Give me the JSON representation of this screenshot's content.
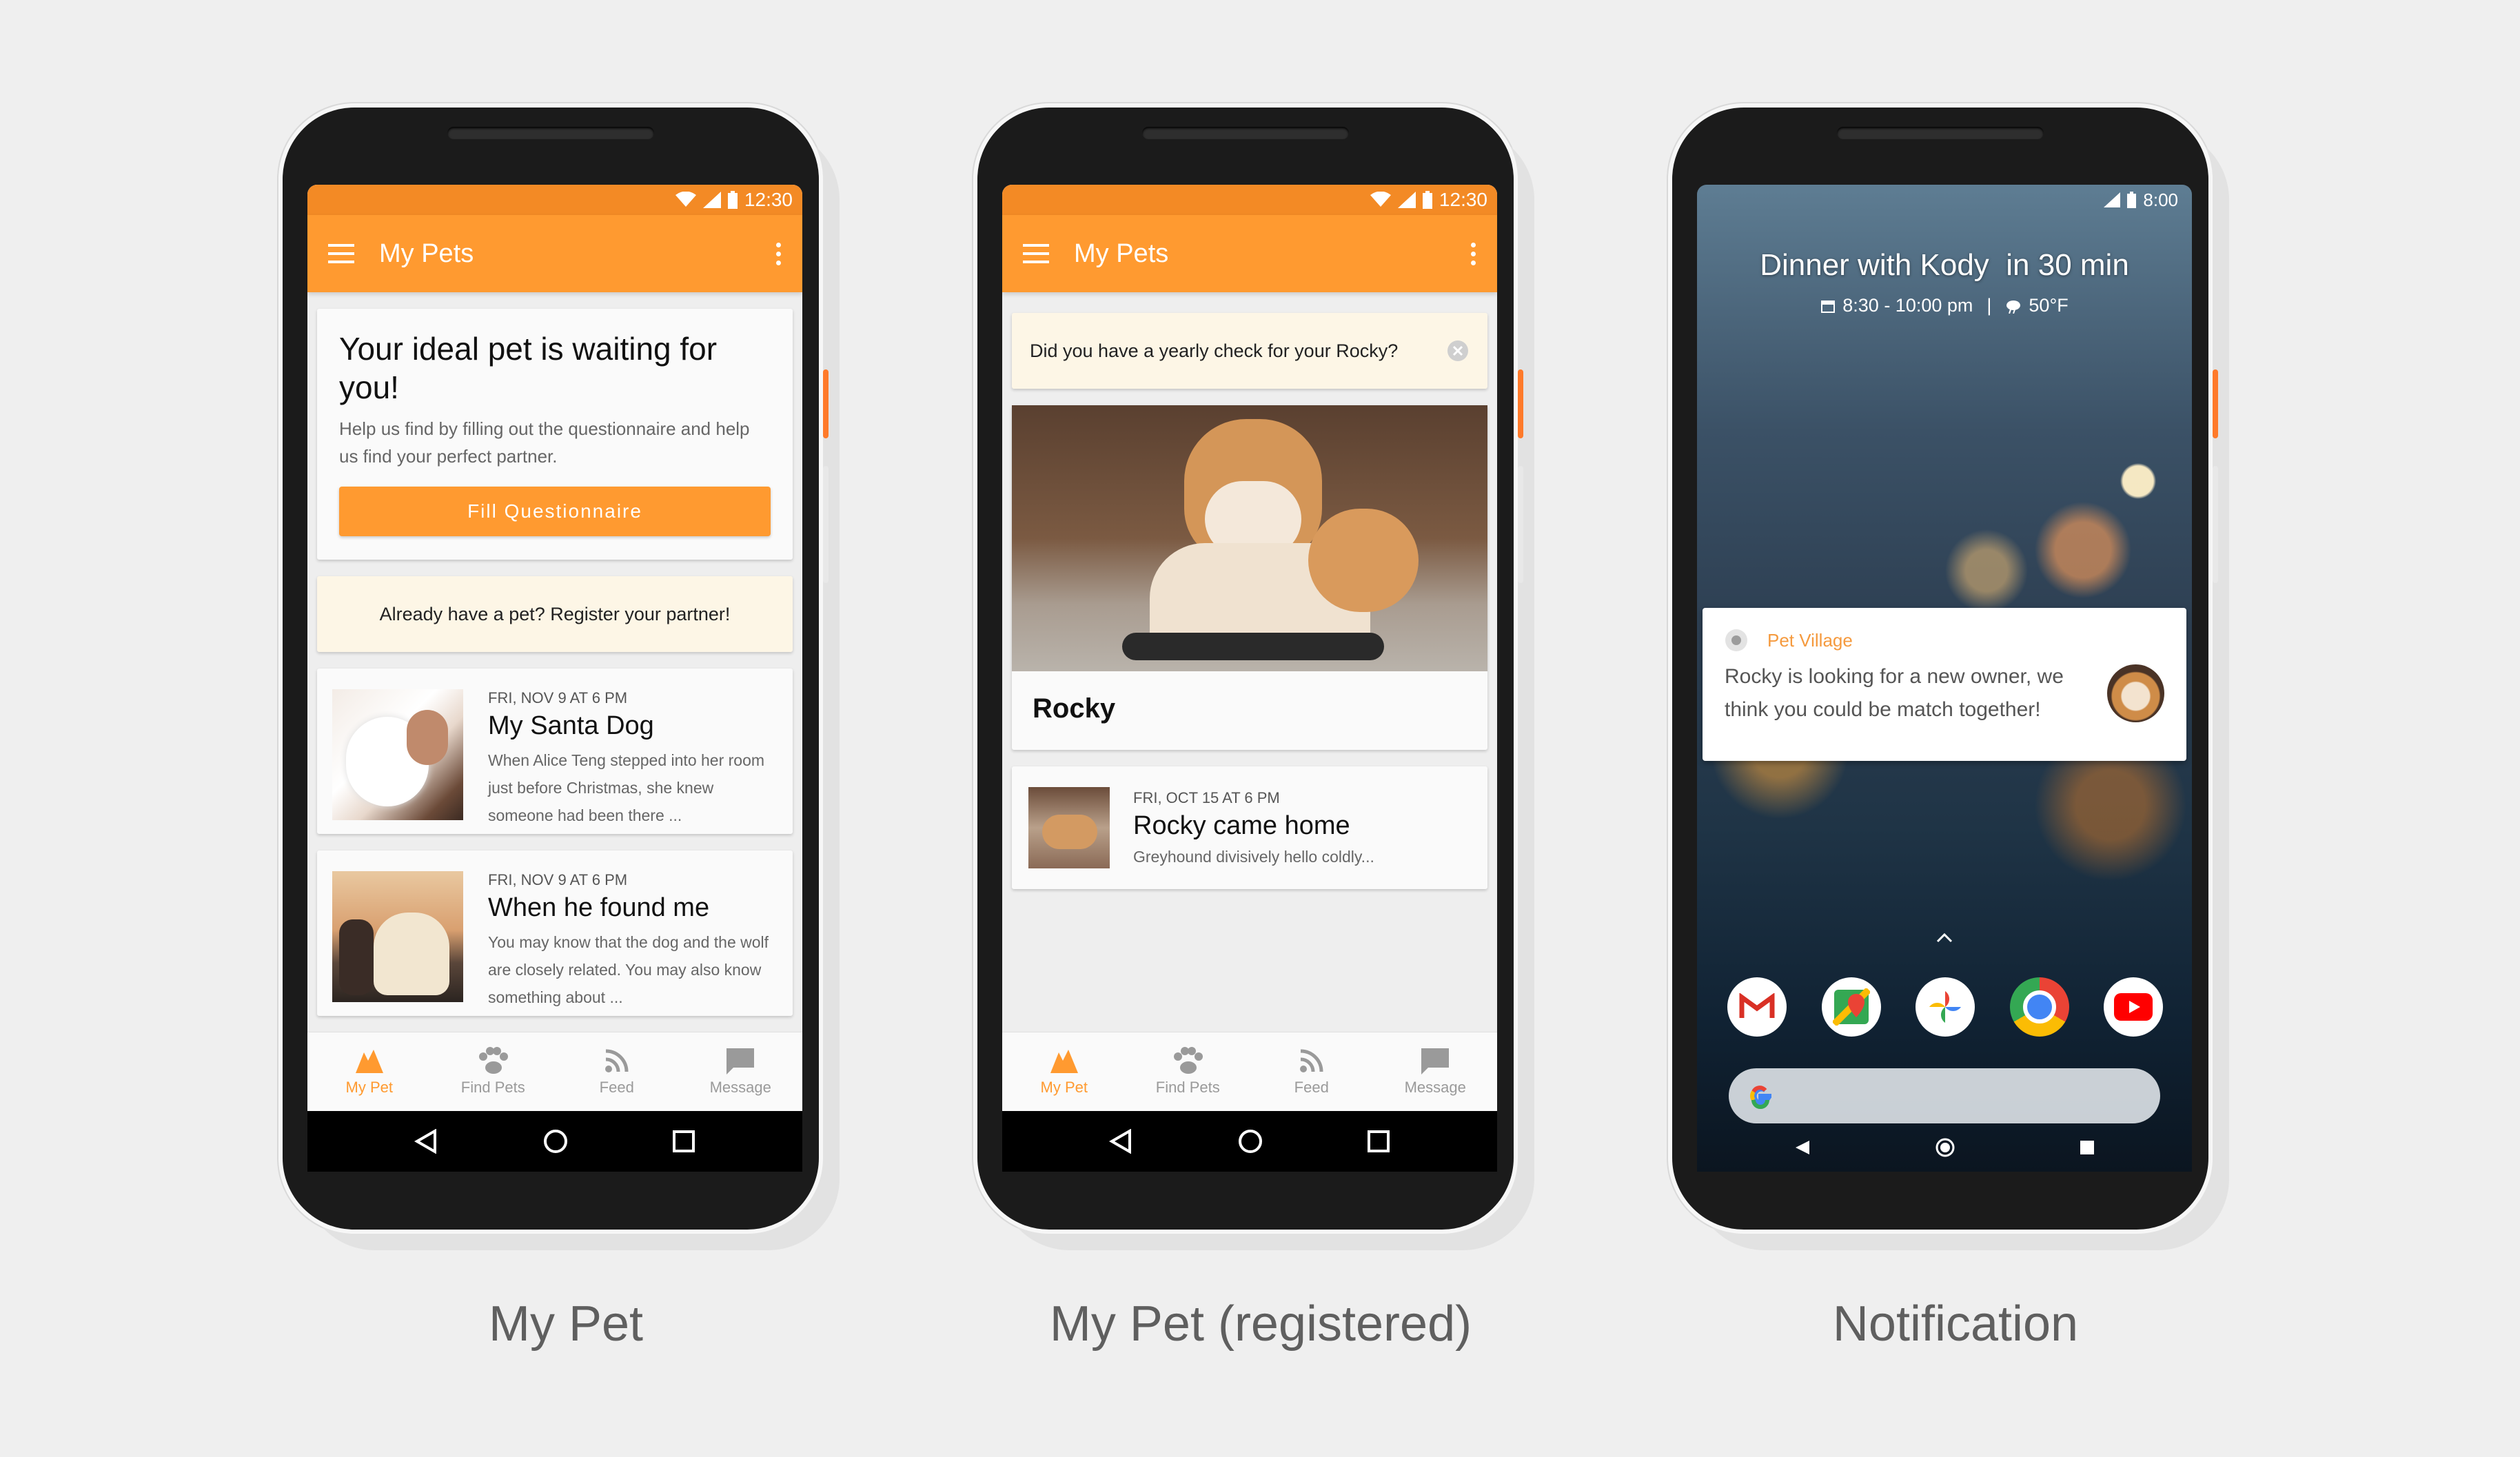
{
  "screen1": {
    "status_time": "12:30",
    "app_title": "My Pets",
    "promo": {
      "heading": "Your ideal pet is waiting for you!",
      "body": "Help us find by filling out the questionnaire and help us find your perfect partner.",
      "button": "Fill Questionnaire"
    },
    "register_banner": "Already have a pet? Register your partner!",
    "feed": [
      {
        "date": "FRI, NOV 9 AT 6 PM",
        "title": "My Santa Dog",
        "body": "When Alice Teng stepped into her room just before Christmas, she knew someone had been there ..."
      },
      {
        "date": "FRI, NOV 9 AT 6 PM",
        "title": "When he found me",
        "body": "You may know that the dog and the wolf are closely related. You may also know something about ..."
      }
    ],
    "nav": [
      "My Pet",
      "Find Pets",
      "Feed",
      "Message"
    ]
  },
  "screen2": {
    "status_time": "12:30",
    "app_title": "My Pets",
    "reminder": "Did you have a yearly check for your Rocky?",
    "pet_name": "Rocky",
    "feed": [
      {
        "date": "FRI, OCT 15 AT 6 PM",
        "title": "Rocky came home",
        "body": "Greyhound divisively hello coldly..."
      }
    ],
    "nav": [
      "My Pet",
      "Find Pets",
      "Feed",
      "Message"
    ]
  },
  "screen3": {
    "status_time": "8:00",
    "event_title": "Dinner with Kody  in 30 min",
    "event_time": "8:30 - 10:00 pm",
    "event_weather": "50°F",
    "notification": {
      "app_name": "Pet Village",
      "message": "Rocky is looking for a new owner, we think you could be match together!"
    }
  },
  "captions": [
    "My Pet",
    "My Pet (registered)",
    "Notification"
  ],
  "colors": {
    "accent": "#ff9a30",
    "status": "#f38a25",
    "banner": "#fdf6e6"
  }
}
